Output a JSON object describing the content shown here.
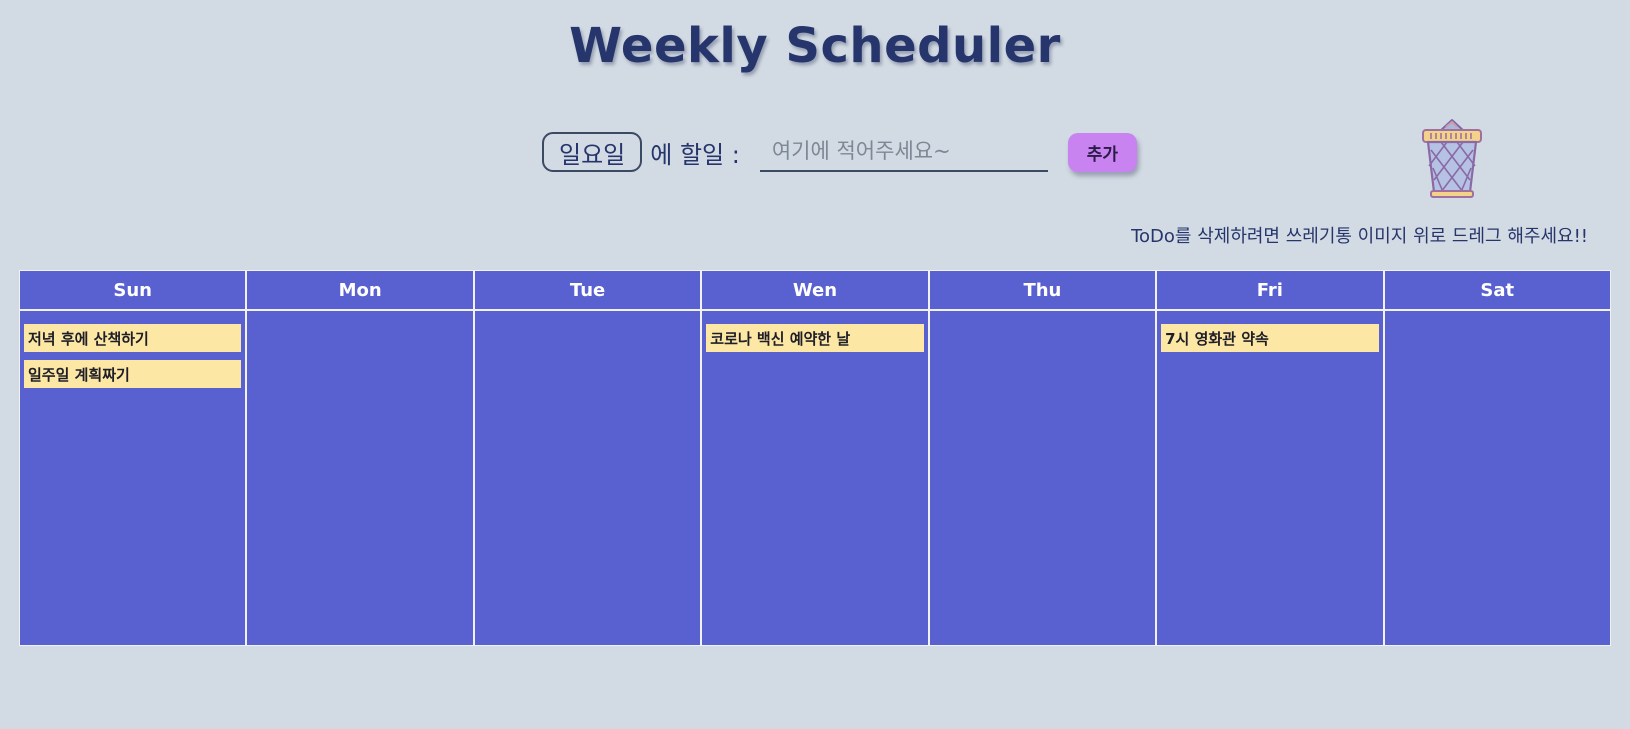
{
  "title": "Weekly Scheduler",
  "controls": {
    "selected_day": "일요일",
    "todo_label": "에 할일 :",
    "input_placeholder": "여기에 적어주세요~",
    "input_value": "",
    "add_label": "추가"
  },
  "trash": {
    "icon": "trash-bin-icon"
  },
  "hint": "ToDo를 삭제하려면 쓰레기통 이미지 위로 드레그 해주세요!!",
  "colors": {
    "background": "#d2dbe3",
    "title": "#26356c",
    "day_panel": "#5960d0",
    "todo_item": "#fde7a4",
    "add_button": "#c883f0"
  },
  "week": {
    "days": [
      {
        "label": "Sun",
        "todos": [
          "저녁 후에 산책하기",
          "일주일 계획짜기"
        ]
      },
      {
        "label": "Mon",
        "todos": []
      },
      {
        "label": "Tue",
        "todos": []
      },
      {
        "label": "Wen",
        "todos": [
          "코로나 백신 예약한 날"
        ]
      },
      {
        "label": "Thu",
        "todos": []
      },
      {
        "label": "Fri",
        "todos": [
          "7시 영화관 약속"
        ]
      },
      {
        "label": "Sat",
        "todos": []
      }
    ]
  }
}
